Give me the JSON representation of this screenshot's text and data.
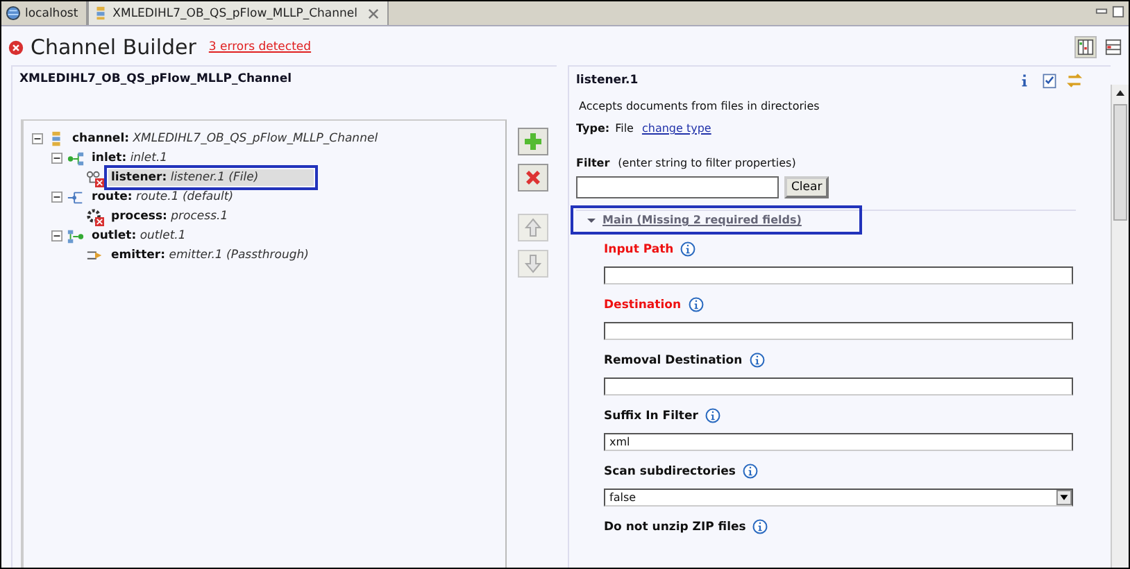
{
  "tabs": [
    {
      "label": "localhost",
      "selected": false,
      "closable": false
    },
    {
      "label": "XMLEDIHL7_OB_QS_pFlow_MLLP_Channel",
      "selected": true,
      "closable": true
    }
  ],
  "header": {
    "title": "Channel Builder",
    "error_link": "3 errors detected"
  },
  "left_panel": {
    "title": "XMLEDIHL7_OB_QS_pFlow_MLLP_Channel",
    "tree": [
      {
        "kind": "channel",
        "label": "channel:",
        "name": "XMLEDIHL7_OB_QS_pFlow_MLLP_Channel",
        "expanded": true,
        "selected": false,
        "error": false,
        "annotated": false,
        "children": [
          {
            "kind": "inlet",
            "label": "inlet:",
            "name": "inlet.1",
            "expanded": true,
            "selected": false,
            "error": false,
            "annotated": false,
            "children": [
              {
                "kind": "listener",
                "label": "listener:",
                "name": "listener.1 (File)",
                "selected": true,
                "error": true,
                "annotated": true
              }
            ]
          },
          {
            "kind": "route",
            "label": "route:",
            "name": "route.1 (default)",
            "expanded": true,
            "selected": false,
            "error": false,
            "annotated": false,
            "children": [
              {
                "kind": "process",
                "label": "process:",
                "name": "process.1",
                "selected": false,
                "error": true,
                "annotated": false
              }
            ]
          },
          {
            "kind": "outlet",
            "label": "outlet:",
            "name": "outlet.1",
            "expanded": true,
            "selected": false,
            "error": false,
            "annotated": false,
            "children": [
              {
                "kind": "emitter",
                "label": "emitter:",
                "name": "emitter.1 (Passthrough)",
                "selected": false,
                "error": false,
                "annotated": false
              }
            ]
          }
        ]
      }
    ],
    "buttons": [
      {
        "kind": "add",
        "disabled": false
      },
      {
        "kind": "delete",
        "disabled": false
      },
      {
        "kind": "up",
        "disabled": true
      },
      {
        "kind": "down",
        "disabled": true
      }
    ]
  },
  "right_panel": {
    "title": "listener.1",
    "description": "Accepts documents from files in directories",
    "type_label": "Type:",
    "type_value": "File",
    "change_link": "change type",
    "filter": {
      "label": "Filter",
      "hint": "(enter string to filter properties)",
      "button": "Clear"
    },
    "section": {
      "title": "Main (Missing 2 required fields)",
      "expanded": true,
      "annotated": true
    },
    "fields": [
      {
        "label": "Input Path",
        "required": true,
        "kind": "text"
      },
      {
        "label": "Destination",
        "required": true,
        "kind": "text"
      },
      {
        "label": "Removal Destination",
        "required": false,
        "kind": "text"
      },
      {
        "label": "Suffix In Filter",
        "required": false,
        "kind": "text",
        "value": "xml"
      },
      {
        "label": "Scan subdirectories",
        "required": false,
        "kind": "select",
        "value": "false"
      },
      {
        "label": "Do not unzip ZIP files",
        "required": false,
        "kind": "hidden"
      }
    ]
  }
}
